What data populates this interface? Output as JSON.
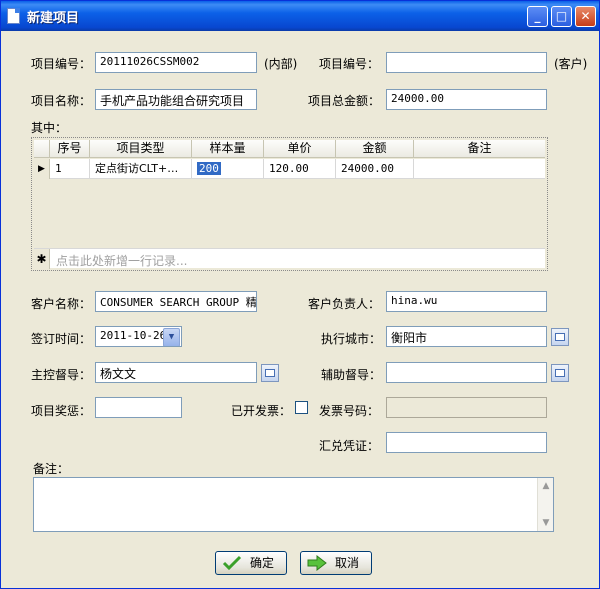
{
  "window": {
    "title": "新建项目"
  },
  "titlebar_buttons": {
    "minimize": "_",
    "maximize": "□",
    "close": "✕"
  },
  "form": {
    "project_no_internal": {
      "label": "项目编号：",
      "value": "20111026CSSM002",
      "suffix": "(内部)"
    },
    "project_no_client": {
      "label": "项目编号：",
      "value": "",
      "suffix": "(客户)"
    },
    "project_name": {
      "label": "项目名称：",
      "value": "手机产品功能组合研究项目"
    },
    "project_total": {
      "label": "项目总金额：",
      "value": "24000.00"
    },
    "breakdown_label": "其中：",
    "client_name": {
      "label": "客户名称：",
      "value": "CONSUMER SEARCH GROUP  精研"
    },
    "client_contact": {
      "label": "客户负责人：",
      "value": "hina.wu"
    },
    "sign_date": {
      "label": "签订时间：",
      "value": "2011-10-26"
    },
    "exec_city": {
      "label": "执行城市：",
      "value": "衡阳市"
    },
    "main_supervisor": {
      "label": "主控督导：",
      "value": "杨文文"
    },
    "assist_supervisor": {
      "label": "辅助督导：",
      "value": ""
    },
    "project_bonus": {
      "label": "项目奖惩：",
      "value": ""
    },
    "invoiced": {
      "label": "已开发票：",
      "checked": false
    },
    "invoice_no": {
      "label": "发票号码：",
      "value": ""
    },
    "exchange_voucher": {
      "label": "汇兑凭证：",
      "value": ""
    },
    "remarks": {
      "label": "备注：",
      "value": ""
    }
  },
  "grid": {
    "columns": [
      "序号",
      "项目类型",
      "样本量",
      "单价",
      "金额",
      "备注"
    ],
    "rows": [
      {
        "seq": "1",
        "type": "定点街访CLT+…",
        "sample": "200",
        "price": "120.00",
        "amount": "24000.00",
        "note": ""
      }
    ],
    "current_row_marker": "▶",
    "new_row_marker": "✱",
    "new_row_placeholder": "点击此处新增一行记录..."
  },
  "actions": {
    "ok": "确定",
    "cancel": "取消"
  },
  "colors": {
    "titlebar": "#0a5fe8",
    "window_bg": "#ece9d8",
    "selection": "#316ac5"
  }
}
